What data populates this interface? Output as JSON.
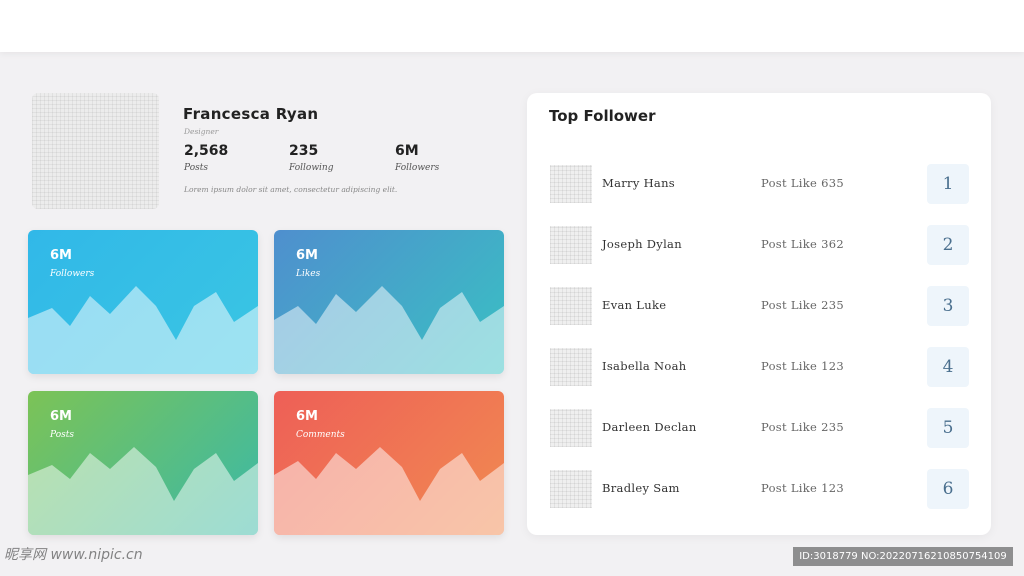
{
  "profile": {
    "name": "Francesca Ryan",
    "role": "Designer",
    "stats": [
      {
        "value": "2,568",
        "label": "Posts"
      },
      {
        "value": "235",
        "label": "Following"
      },
      {
        "value": "6M",
        "label": "Followers"
      }
    ],
    "bio": "Lorem ipsum dolor sit amet, consectetur adipiscing elit."
  },
  "cards": [
    {
      "value": "6M",
      "label": "Followers"
    },
    {
      "value": "6M",
      "label": "Likes"
    },
    {
      "value": "6M",
      "label": "Posts"
    },
    {
      "value": "6M",
      "label": "Comments"
    }
  ],
  "top_follower": {
    "title": "Top Follower",
    "rows": [
      {
        "name": "Marry Hans",
        "likes": "Post Like 635",
        "rank": "1"
      },
      {
        "name": "Joseph Dylan",
        "likes": "Post Like 362",
        "rank": "2"
      },
      {
        "name": "Evan Luke",
        "likes": "Post Like 235",
        "rank": "3"
      },
      {
        "name": "Isabella Noah",
        "likes": "Post Like 123",
        "rank": "4"
      },
      {
        "name": "Darleen Declan",
        "likes": "Post Like 235",
        "rank": "5"
      },
      {
        "name": "Bradley Sam",
        "likes": "Post Like 123",
        "rank": "6"
      }
    ]
  },
  "watermark": {
    "left": "昵享网 www.nipic.cn",
    "right": "ID:3018779 NO:20220716210850754109"
  }
}
